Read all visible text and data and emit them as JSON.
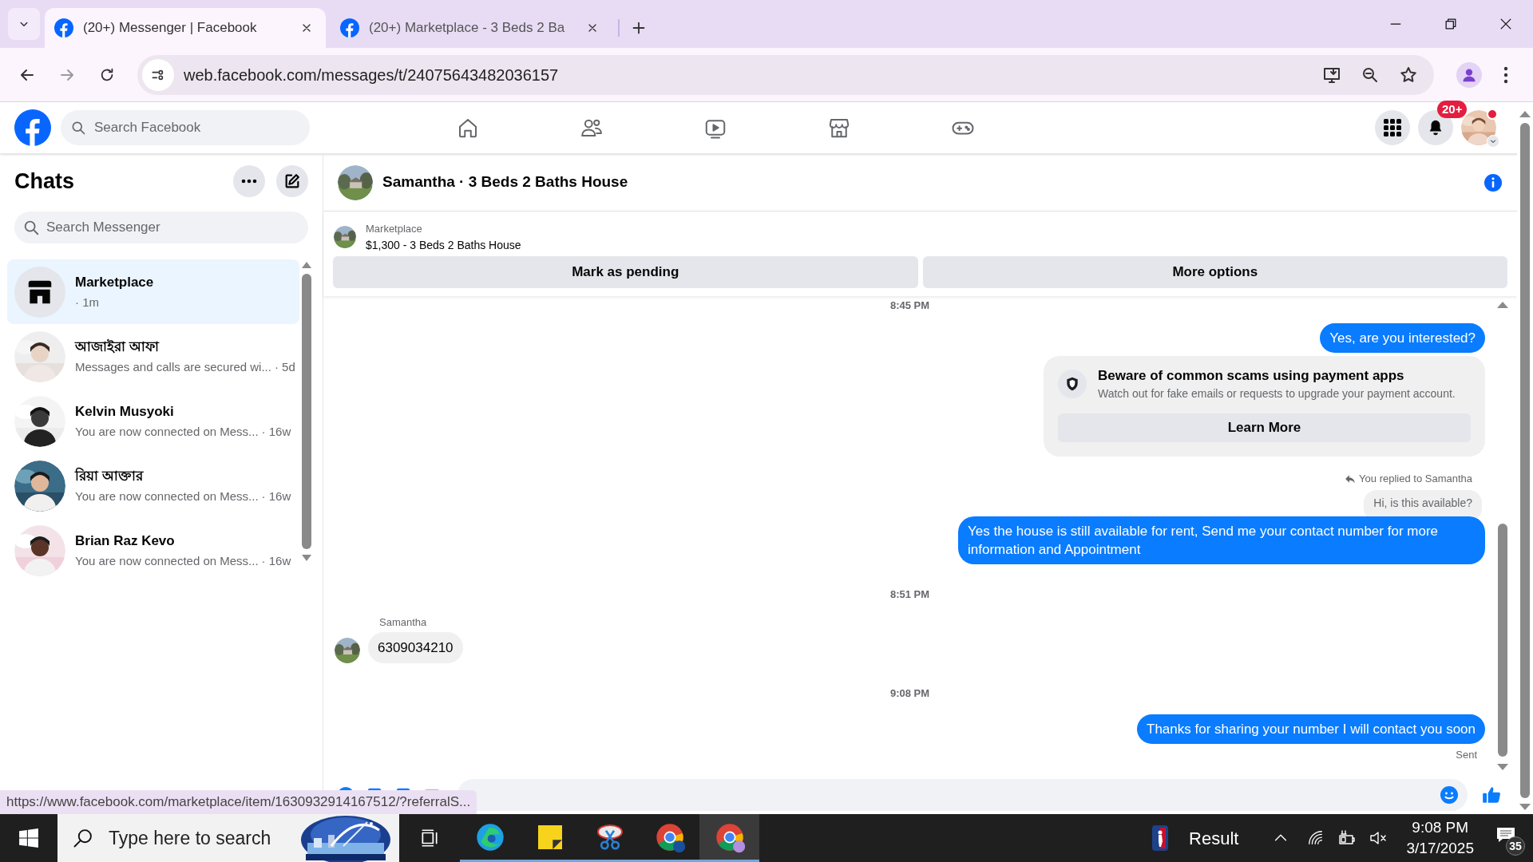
{
  "browser": {
    "tabs": [
      {
        "title": "(20+) Messenger | Facebook",
        "selected": true
      },
      {
        "title": "(20+) Marketplace - 3 Beds 2 Ba",
        "selected": false
      }
    ],
    "url": "web.facebook.com/messages/t/24075643482036157"
  },
  "facebook": {
    "search_placeholder": "Search Facebook",
    "notification_badge": "20+"
  },
  "chats": {
    "title": "Chats",
    "search_placeholder": "Search Messenger",
    "items": [
      {
        "kind": "store",
        "name": "Marketplace",
        "time": "· 1m",
        "selected": true
      },
      {
        "kind": "person",
        "name": "আজাইরা আফা",
        "preview": "Messages and calls are secured wi...",
        "time": "· 5d",
        "selected": false
      },
      {
        "kind": "person",
        "name": "Kelvin Musyoki",
        "preview": "You are now connected on Mess...",
        "time": "· 16w",
        "selected": false
      },
      {
        "kind": "person",
        "name": "রিয়া আক্তার",
        "preview": "You are now connected on Mess...",
        "time": "· 16w",
        "selected": false
      },
      {
        "kind": "person",
        "name": "Brian Raz Kevo",
        "preview": "You are now connected on Mess...",
        "time": "· 16w",
        "selected": false
      }
    ]
  },
  "conversation": {
    "title": "Samantha · 3 Beds 2 Baths House",
    "listing_source": "Marketplace",
    "listing": "$1,300 - 3 Beds 2 Baths House",
    "actions": [
      "Mark as pending",
      "More options"
    ],
    "messages": [
      {
        "kind": "timestamp",
        "text": "8:45 PM"
      },
      {
        "kind": "outgoing",
        "text": "Yes, are you interested?"
      },
      {
        "kind": "notice",
        "title": "Beware of common scams using payment apps",
        "text": "Watch out for fake emails or requests to upgrade your payment account.",
        "button": "Learn More"
      },
      {
        "kind": "reply_note",
        "text": "You replied to Samantha"
      },
      {
        "kind": "quoted",
        "text": "Hi, is this available?"
      },
      {
        "kind": "outgoing",
        "text": "Yes the house is still available for rent, Send me your contact number for more information and Appointment"
      },
      {
        "kind": "timestamp",
        "text": "8:51 PM"
      },
      {
        "kind": "incoming",
        "sender": "Samantha",
        "text": "6309034210"
      },
      {
        "kind": "timestamp",
        "text": "9:08 PM"
      },
      {
        "kind": "outgoing",
        "text": "Thanks for sharing your number I will contact you soon"
      },
      {
        "kind": "status",
        "text": "Sent"
      }
    ]
  },
  "status_url": "https://www.facebook.com/marketplace/item/1630932914167512/?referralS...",
  "taskbar": {
    "search_placeholder": "Type here to search",
    "weather": "Result",
    "time": "9:08 PM",
    "date": "3/17/2025",
    "notifications": "35"
  }
}
